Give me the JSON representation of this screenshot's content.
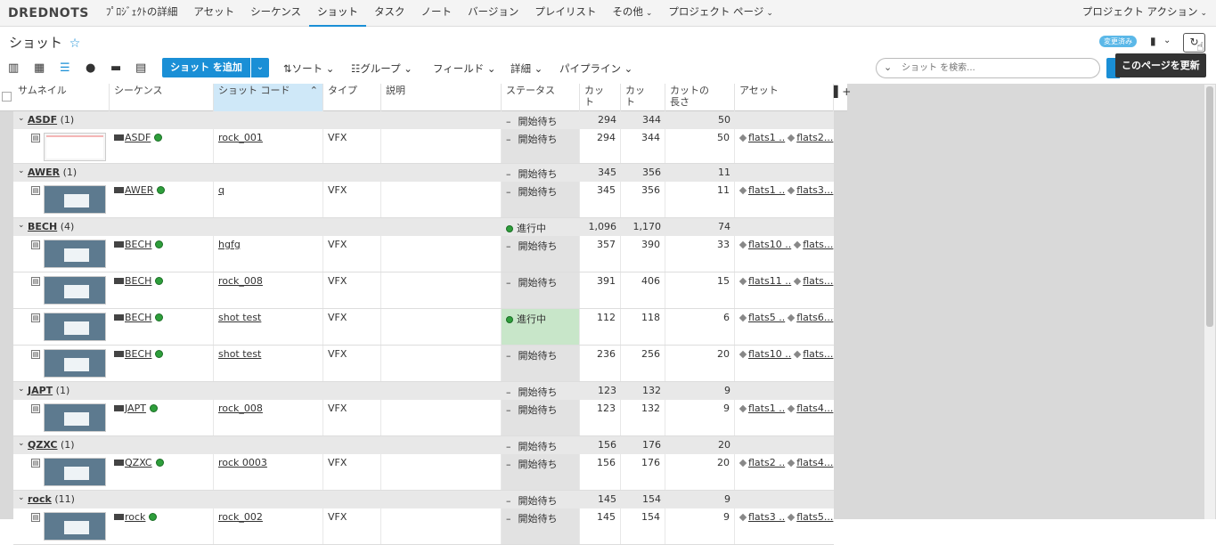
{
  "nav": {
    "brand": "DREDNOTS",
    "items": [
      "ﾌﾟﾛｼﾞｪｸﾄの詳細",
      "アセット",
      "シーケンス",
      "ショット",
      "タスク",
      "ノート",
      "バージョン",
      "プレイリスト",
      "その他",
      "プロジェクト ページ"
    ],
    "active": "ショット",
    "right": "プロジェクト アクション"
  },
  "title": {
    "page_title": "ショット",
    "star": "☆",
    "badge": "変更済み",
    "tooltip": "このページを更新"
  },
  "toolbar": {
    "add_label": "ショット を追加",
    "sort": "ソート",
    "group": "グループ",
    "fields": "フィールド",
    "details": "詳細",
    "pipeline": "パイプライン",
    "search_placeholder": "ショット を検索..."
  },
  "columns": [
    "サムネイル",
    "シーケンス",
    "ショット コード",
    "タイプ",
    "説明",
    "ステータス",
    "カット",
    "カット",
    "カットの長さ",
    "アセット"
  ],
  "column_lines": {
    "cut_in": [
      "カッ",
      "ト"
    ],
    "cut_out": [
      "カッ",
      "ト"
    ],
    "cut_len": [
      "カットの",
      "長さ"
    ]
  },
  "groups": [
    {
      "name": "ASDF",
      "count": "(1)",
      "status": "開始待ち",
      "in": "294",
      "out": "344",
      "len": "50",
      "rows": [
        {
          "seq": "ASDF",
          "code": "rock_001",
          "type": "VFX",
          "status": "開始待ち",
          "in": "294",
          "out": "344",
          "len": "50",
          "a1": "flats1 ..",
          "a2": "flats2..."
        }
      ]
    },
    {
      "name": "AWER",
      "count": "(1)",
      "status": "開始待ち",
      "in": "345",
      "out": "356",
      "len": "11",
      "rows": [
        {
          "seq": "AWER",
          "code": "q",
          "type": "VFX",
          "status": "開始待ち",
          "in": "345",
          "out": "356",
          "len": "11",
          "a1": "flats1 ..",
          "a2": "flats3..."
        }
      ]
    },
    {
      "name": "BECH",
      "count": "(4)",
      "status": "進行中",
      "in": "1,096",
      "out": "1,170",
      "len": "74",
      "rows": [
        {
          "seq": "BECH",
          "code": "hgfg",
          "type": "VFX",
          "status": "開始待ち",
          "in": "357",
          "out": "390",
          "len": "33",
          "a1": "flats10 ..",
          "a2": "flats..."
        },
        {
          "seq": "BECH",
          "code": "rock_008",
          "type": "VFX",
          "status": "開始待ち",
          "in": "391",
          "out": "406",
          "len": "15",
          "a1": "flats11 ..",
          "a2": "flats..."
        },
        {
          "seq": "BECH",
          "code": "shot test",
          "type": "VFX",
          "status": "進行中",
          "in": "112",
          "out": "118",
          "len": "6",
          "a1": "flats5 ..",
          "a2": "flats6..."
        },
        {
          "seq": "BECH",
          "code": "shot test",
          "type": "VFX",
          "status": "開始待ち",
          "in": "236",
          "out": "256",
          "len": "20",
          "a1": "flats10 ..",
          "a2": "flats..."
        }
      ]
    },
    {
      "name": "JAPT",
      "count": "(1)",
      "status": "開始待ち",
      "in": "123",
      "out": "132",
      "len": "9",
      "rows": [
        {
          "seq": "JAPT",
          "code": "rock_008",
          "type": "VFX",
          "status": "開始待ち",
          "in": "123",
          "out": "132",
          "len": "9",
          "a1": "flats1 ..",
          "a2": "flats4..."
        }
      ]
    },
    {
      "name": "QZXC",
      "count": "(1)",
      "status": "開始待ち",
      "in": "156",
      "out": "176",
      "len": "20",
      "rows": [
        {
          "seq": "QZXC",
          "code": "rock 0003",
          "type": "VFX",
          "status": "開始待ち",
          "in": "156",
          "out": "176",
          "len": "20",
          "a1": "flats2 ..",
          "a2": "flats4..."
        }
      ]
    },
    {
      "name": "rock",
      "count": "(11)",
      "status": "開始待ち",
      "in": "145",
      "out": "154",
      "len": "9",
      "rows": [
        {
          "seq": "rock",
          "code": "rock_002",
          "type": "VFX",
          "status": "開始待ち",
          "in": "145",
          "out": "154",
          "len": "9",
          "a1": "flats3 ..",
          "a2": "flats5..."
        }
      ]
    }
  ]
}
